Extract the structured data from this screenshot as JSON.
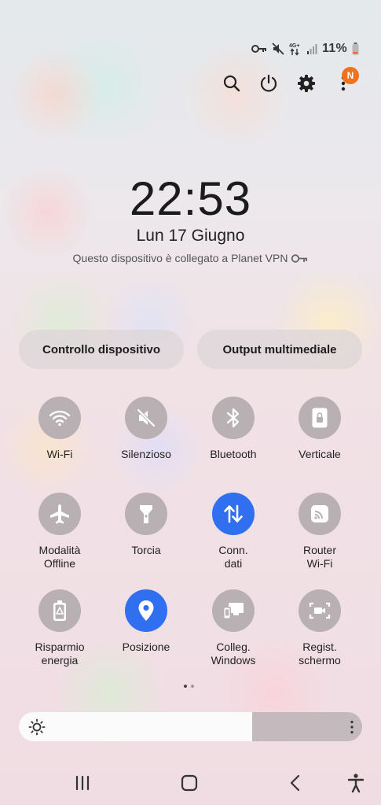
{
  "status_bar": {
    "battery_percent": "11%",
    "network": "4G+",
    "icons": [
      "vpn-key-icon",
      "mute-icon",
      "data-arrows-icon",
      "signal-icon",
      "battery-icon"
    ]
  },
  "top_icons": [
    "search-icon",
    "power-icon",
    "gear-icon",
    "more-vert-icon"
  ],
  "notification_badge": "N",
  "clock": {
    "time": "22:53",
    "date": "Lun 17 Giugno",
    "vpn_message": "Questo dispositivo è collegato a Planet VPN"
  },
  "pills": {
    "device_control": "Controllo dispositivo",
    "media_output": "Output multimediale"
  },
  "tiles": [
    {
      "label": "Wi-Fi",
      "icon": "wifi-icon",
      "active": false
    },
    {
      "label": "Silenzioso",
      "icon": "mute-icon",
      "active": false
    },
    {
      "label": "Bluetooth",
      "icon": "bluetooth-icon",
      "active": false
    },
    {
      "label": "Verticale",
      "icon": "rotation-lock-icon",
      "active": false
    },
    {
      "label": "Modalità\nOffline",
      "icon": "airplane-icon",
      "active": false
    },
    {
      "label": "Torcia",
      "icon": "flashlight-icon",
      "active": false
    },
    {
      "label": "Conn.\ndati",
      "icon": "mobile-data-icon",
      "active": true
    },
    {
      "label": "Router\nWi-Fi",
      "icon": "hotspot-icon",
      "active": false
    },
    {
      "label": "Risparmio\nenergia",
      "icon": "battery-saver-icon",
      "active": false
    },
    {
      "label": "Posizione",
      "icon": "location-icon",
      "active": true
    },
    {
      "label": "Colleg.\nWindows",
      "icon": "link-windows-icon",
      "active": false
    },
    {
      "label": "Regist.\nschermo",
      "icon": "screen-record-icon",
      "active": false
    }
  ],
  "page_indicator": {
    "current": 1,
    "total": 2
  },
  "brightness": {
    "level": 0.68,
    "icons": [
      "sun-icon",
      "more-vert-icon"
    ]
  },
  "nav_bar": [
    "recents-icon",
    "home-icon",
    "back-icon",
    "accessibility-icon"
  ],
  "colors": {
    "accent": "#2f6ff0",
    "badge": "#f2711f",
    "tile_off": "#b9b0b3"
  }
}
